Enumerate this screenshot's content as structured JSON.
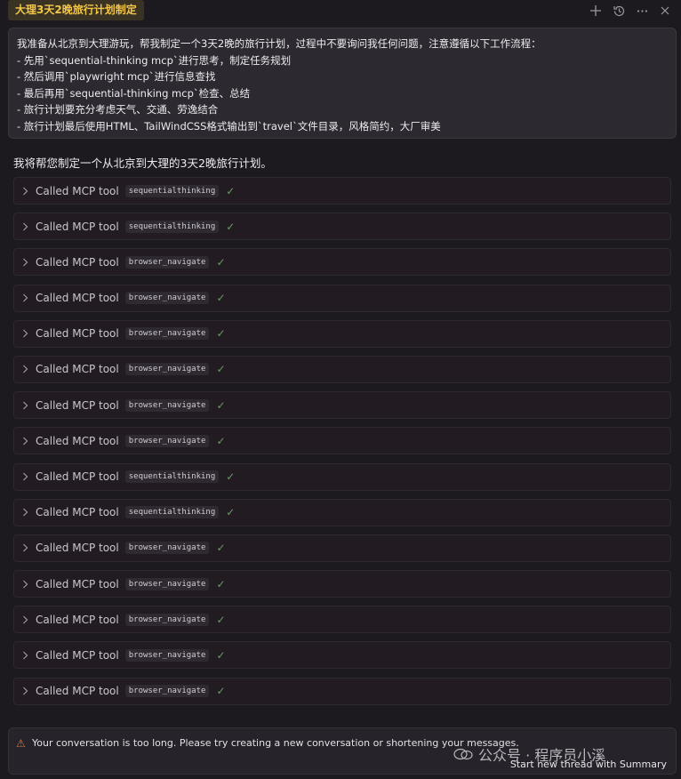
{
  "tab": {
    "title": "大理3天2晚旅行计划制定"
  },
  "prompt": {
    "lines": [
      "我准备从北京到大理游玩，帮我制定一个3天2晚的旅行计划，过程中不要询问我任何问题，注意遵循以下工作流程：",
      "- 先用`sequential-thinking mcp`进行思考，制定任务规划",
      "- 然后调用`playwright mcp`进行信息查找",
      "- 最后再用`sequential-thinking mcp`检查、总结",
      "- 旅行计划要充分考虑天气、交通、劳逸结合",
      "- 旅行计划最后使用HTML、TailWindCSS格式输出到`travel`文件目录，风格简约，大厂审美"
    ]
  },
  "response": {
    "text": "我将帮您制定一个从北京到大理的3天2晚旅行计划。"
  },
  "tool_calls": [
    {
      "label": "Called MCP tool",
      "tool": "sequentialthinking"
    },
    {
      "label": "Called MCP tool",
      "tool": "sequentialthinking"
    },
    {
      "label": "Called MCP tool",
      "tool": "browser_navigate"
    },
    {
      "label": "Called MCP tool",
      "tool": "browser_navigate"
    },
    {
      "label": "Called MCP tool",
      "tool": "browser_navigate"
    },
    {
      "label": "Called MCP tool",
      "tool": "browser_navigate"
    },
    {
      "label": "Called MCP tool",
      "tool": "browser_navigate"
    },
    {
      "label": "Called MCP tool",
      "tool": "browser_navigate"
    },
    {
      "label": "Called MCP tool",
      "tool": "sequentialthinking"
    },
    {
      "label": "Called MCP tool",
      "tool": "sequentialthinking"
    },
    {
      "label": "Called MCP tool",
      "tool": "browser_navigate"
    },
    {
      "label": "Called MCP tool",
      "tool": "browser_navigate"
    },
    {
      "label": "Called MCP tool",
      "tool": "browser_navigate"
    },
    {
      "label": "Called MCP tool",
      "tool": "browser_navigate"
    },
    {
      "label": "Called MCP tool",
      "tool": "browser_navigate"
    }
  ],
  "banner": {
    "warning": "Your conversation is too long. Please try creating a new conversation or shortening your messages.",
    "summary_button": "Start new thread with Summary"
  },
  "watermark": {
    "text": "公众号 · 程序员小溪"
  },
  "icons": {
    "new": "plus-icon",
    "history": "history-icon",
    "more": "more-icon",
    "close": "close-icon"
  },
  "colors": {
    "tab_accent": "#f3c64a",
    "check": "#6b9a6a",
    "warning": "#e0743a"
  }
}
